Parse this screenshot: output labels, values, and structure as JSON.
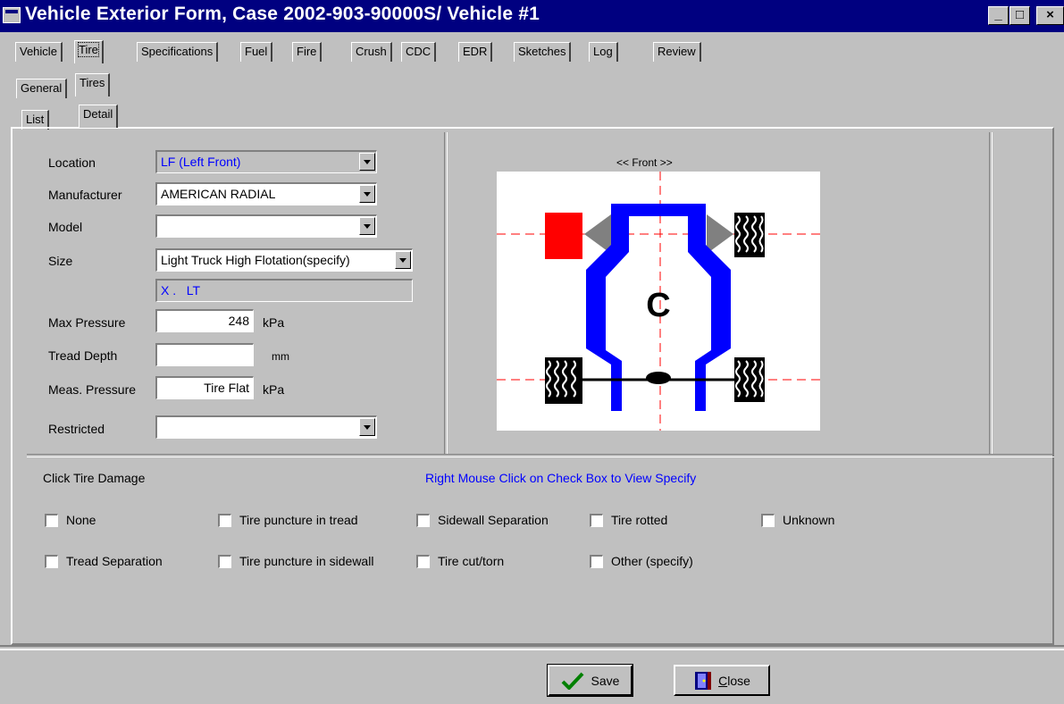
{
  "window": {
    "title": "Vehicle Exterior Form, Case 2002-903-90000S/ Vehicle #1",
    "controls": [
      "_",
      "□",
      "×"
    ]
  },
  "main_tabs": [
    "Vehicle",
    "Tire",
    "Specifications",
    "Fuel",
    "Fire",
    "Crush",
    "CDC",
    "EDR",
    "Sketches",
    "Log",
    "Review"
  ],
  "main_tab_selected": "Tire",
  "sub_tabs": [
    "General",
    "Tires"
  ],
  "sub_tab_selected": "Tires",
  "detail_tabs": [
    "List",
    "Detail"
  ],
  "detail_tab_selected": "Detail",
  "form": {
    "location": {
      "label": "Location",
      "value": "LF (Left Front)"
    },
    "manufacturer": {
      "label": "Manufacturer",
      "value": "AMERICAN RADIAL"
    },
    "model": {
      "label": "Model",
      "value": ""
    },
    "size": {
      "label": "Size",
      "value": "Light Truck High Flotation(specify)",
      "specify_value": "X .   LT"
    },
    "max_pressure": {
      "label": "Max Pressure",
      "value": "248",
      "unit": "kPa"
    },
    "tread_depth": {
      "label": "Tread Depth",
      "value": "",
      "unit": "mm"
    },
    "meas_pressure": {
      "label": "Meas. Pressure",
      "value": "Tire Flat",
      "unit": "kPa"
    },
    "restricted": {
      "label": "Restricted",
      "value": ""
    }
  },
  "diagram": {
    "caption": "<< Front >>",
    "center_label": "C",
    "selected_tire": "LF",
    "selected_color": "#ff0000",
    "frame_color": "#0000ff"
  },
  "damage": {
    "title": "Click Tire Damage",
    "hint": "Right Mouse Click on Check Box  to View Specify",
    "hint_color": "#0000ff",
    "options": [
      {
        "label": "None",
        "checked": false
      },
      {
        "label": "Tire puncture in tread",
        "checked": false
      },
      {
        "label": "Sidewall Separation",
        "checked": false
      },
      {
        "label": "Tire rotted",
        "checked": false
      },
      {
        "label": "Unknown",
        "checked": false
      },
      {
        "label": "Tread Separation",
        "checked": false
      },
      {
        "label": "Tire puncture in sidewall",
        "checked": false
      },
      {
        "label": "Tire cut/torn",
        "checked": false
      },
      {
        "label": "Other (specify)",
        "checked": false
      }
    ]
  },
  "buttons": {
    "save": {
      "label": "Save",
      "icon": "checkmark-icon"
    },
    "close": {
      "label_underlined": "C",
      "label_rest": "lose",
      "icon": "door-icon"
    }
  }
}
